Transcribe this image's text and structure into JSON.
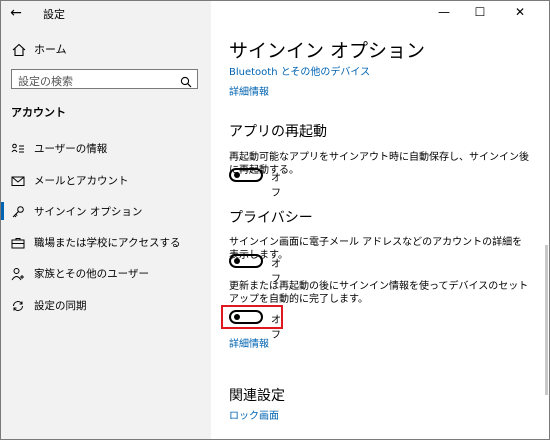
{
  "window": {
    "title": "設定",
    "controls": {
      "minimize": "—",
      "maximize": "☐",
      "close": "✕"
    }
  },
  "nav": {
    "back_glyph": "←",
    "home_label": "ホーム",
    "search_placeholder": "設定の検索",
    "section_title": "アカウント",
    "items": [
      {
        "label": "ユーザーの情報",
        "icon": "user-info-icon"
      },
      {
        "label": "メールとアカウント",
        "icon": "mail-icon"
      },
      {
        "label": "サインイン オプション",
        "icon": "key-icon",
        "selected": true
      },
      {
        "label": "職場または学校にアクセスする",
        "icon": "briefcase-icon"
      },
      {
        "label": "家族とその他のユーザー",
        "icon": "person-add-icon"
      },
      {
        "label": "設定の同期",
        "icon": "sync-icon"
      }
    ]
  },
  "main": {
    "title": "サインイン オプション",
    "bluetooth_link": "Bluetooth とその他のデバイス",
    "details_link_1": "詳細情報",
    "restart_apps": {
      "heading": "アプリの再起動",
      "description": "再起動可能なアプリをサインアウト時に自動保存し、サインイン後に再起動する。",
      "toggle_state": "オフ"
    },
    "privacy": {
      "heading": "プライバシー",
      "show_account_details": {
        "description": "サインイン画面に電子メール アドレスなどのアカウントの詳細を表示します。",
        "toggle_state": "オフ"
      },
      "use_signin_info": {
        "description": "更新または再起動の後にサインイン情報を使ってデバイスのセットアップを自動的に完了します。",
        "toggle_state": "オフ"
      },
      "details_link": "詳細情報"
    },
    "related": {
      "heading": "関連設定",
      "lock_screen_link": "ロック画面"
    }
  },
  "colors": {
    "accent": "#0063b1",
    "highlight": "#e0191e",
    "nav_bg": "#f2f2f2"
  }
}
